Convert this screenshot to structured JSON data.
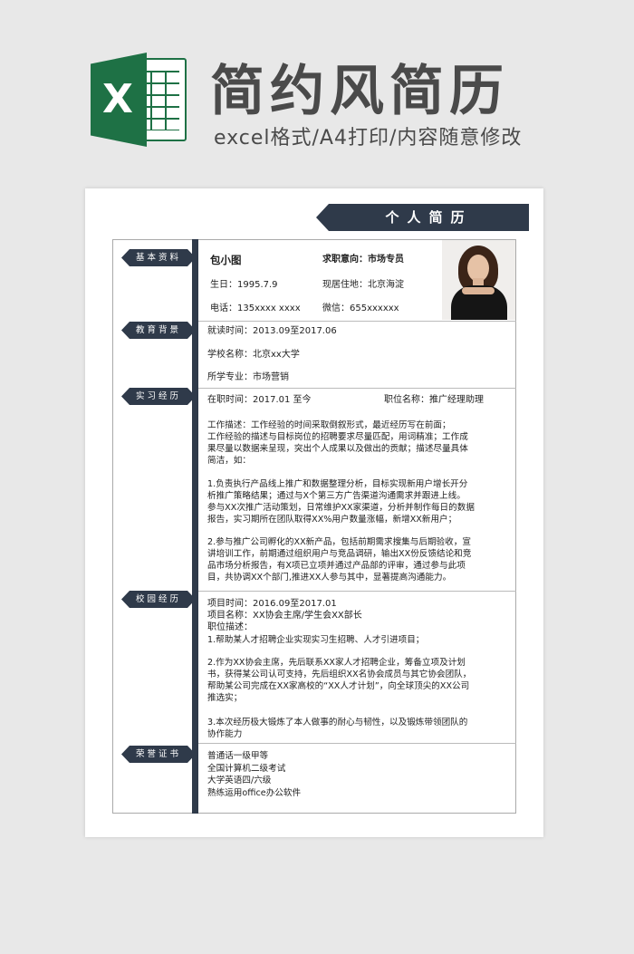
{
  "header": {
    "logo_letter": "X",
    "title": "简约风简历",
    "subtitle": "excel格式/A4打印/内容随意修改"
  },
  "resume": {
    "title": "个人简历",
    "sections": {
      "basic": "基本资料",
      "education": "教育背景",
      "internship": "实习经历",
      "campus": "校园经历",
      "awards": "荣誉证书"
    },
    "basic": {
      "name": "包小图",
      "job_intent": "求职意向：市场专员",
      "birth": "生日：1995.7.9",
      "residence": "现居住地：北京海淀",
      "phone": "电话：135xxxx xxxx",
      "wechat": "微信：655xxxxxx"
    },
    "education": {
      "period": "就读时间：2013.09至2017.06",
      "school": "学校名称：北京xx大学",
      "major": "所学专业：市场营销"
    },
    "internship": {
      "period": "在职时间：2017.01 至今",
      "position": "职位名称：推广经理助理",
      "desc": [
        "工作描述：工作经验的时间采取倒叙形式，最近经历写在前面；",
        "工作经验的描述与目标岗位的招聘要求尽量匹配，用词精准；工作成",
        "果尽量以数据来呈现，突出个人成果以及做出的贡献；描述尽量具体",
        "简洁，如："
      ],
      "item1": [
        "1.负责执行产品线上推广和数据整理分析，目标实现新用户增长开分",
        "析推广策略结果；通过与X个第三方广告渠道沟通需求并跟进上线。",
        "参与XX次推广活动策划，日常维护XX家渠道，分析并制作每日的数据",
        "报告，实习期所在团队取得XX%用户数量涨幅，新增XX新用户；"
      ],
      "item2": [
        "2.参与推广公司孵化的XX新产品，包括前期需求搜集与后期验收，宣",
        "讲培训工作，前期通过组织用户与竞品调研，输出XX份反馈结论和竞",
        "品市场分析报告，有X项已立项并通过产品部的评审，通过参与此项",
        "目，共协调XX个部门,推进XX人参与其中，显著提高沟通能力。"
      ]
    },
    "campus": {
      "period": "项目时间：2016.09至2017.01",
      "name": "项目名称：XX协会主席/学生会XX部长",
      "desc_label": "职位描述：",
      "item1": [
        "1.帮助某人才招聘企业实现实习生招聘、人才引进项目；"
      ],
      "item2": [
        "2.作为XX协会主席，先后联系XX家人才招聘企业，筹备立项及计划",
        "书，获得某公司认可支持，先后组织XX名协会成员与其它协会团队，",
        "帮助某公司完成在XX家高校的“XX人才计划”，向全球顶尖的XX公司",
        "推选实；"
      ],
      "item3": [
        "3.本次经历极大锻炼了本人做事的耐心与韧性，以及锻炼带领团队的",
        "协作能力"
      ]
    },
    "awards": [
      "普通话一级甲等",
      "全国计算机二级考试",
      "大学英语四/六级",
      "熟练运用office办公软件"
    ]
  },
  "colors": {
    "accent": "#2f3a4a",
    "excel_green": "#1e7145",
    "title_gray": "#4a4a4a",
    "background": "#e8e8e8"
  },
  "icons": {
    "logo": "excel-logo-icon",
    "photo": "profile-photo"
  }
}
